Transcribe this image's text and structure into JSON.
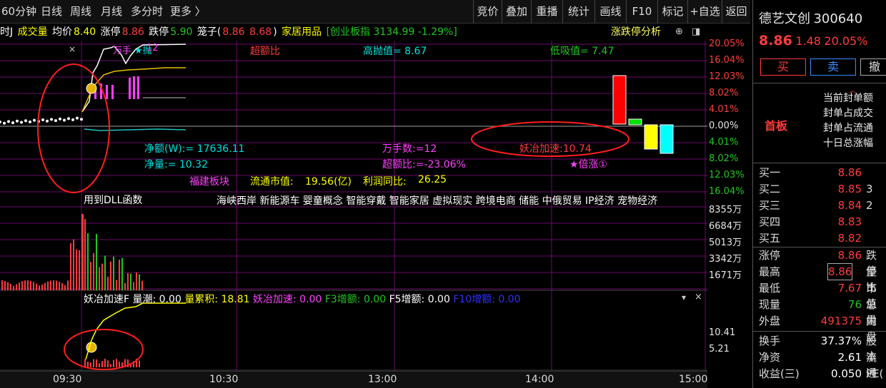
{
  "toolbar": {
    "periods": [
      "60分钟",
      "日线",
      "周线",
      "月线",
      "多分时",
      "更多 〉"
    ],
    "buttons": [
      "竞价",
      "叠加",
      "重播",
      "统计",
      "画线",
      "F10",
      "标记",
      "+自选",
      "返回"
    ]
  },
  "info": {
    "mode": "时J",
    "vol_label": "成交量",
    "avg_label": "均价",
    "avg": "8.40",
    "zt_label": "涨停",
    "zt": "8.86",
    "dt_label": "跌停",
    "dt": "5.90",
    "cage": "笼子(",
    "cage_lo": "8.86",
    "cage_hi": "8.68",
    ")": ")",
    "industry": "家居用品",
    "index": "[创业板指 3134.99 -1.29%]",
    "analysis": "涨跌停分析"
  },
  "chart": {
    "labels": {
      "wanshou": "万手",
      "paofu": "★抛",
      "num12": "12",
      "chaoe": "超额比",
      "gaopao": "高抛值= 8.67",
      "dixi": "低吸值= 7.47",
      "jinge": "净额(W):= 17636.11",
      "wanshoushu": "万手数:=12",
      "yaoye": "妖冶加速:10.74",
      "jingliang": "净量:= 10.32",
      "chaoebi": "超额比:=-23.06%",
      "beizhang": "★倍涨①",
      "region": "福建板块",
      "float": "流通市值:",
      "float_v": "19.56(亿)",
      "profit": "利润同比:",
      "profit_v": "26.25",
      "dll": "用到DLL函数",
      "concepts": "海峡西岸 新能源车 婴童概念 智能穿戴 智能家居 虚拟现实 跨境电商 储能 中俄贸易 IP经济 宠物经济"
    },
    "pct_axis": [
      {
        "t": "20.05%",
        "c": "#ff3c3c"
      },
      {
        "t": "16.04%",
        "c": "#ff3c3c"
      },
      {
        "t": "12.03%",
        "c": "#ff3c3c"
      },
      {
        "t": "8.02%",
        "c": "#ff3c3c"
      },
      {
        "t": "4.01%",
        "c": "#ff3c3c"
      },
      {
        "t": "0.00%",
        "c": "#e6e6e6"
      },
      {
        "t": "4.01%",
        "c": "#1ec81e"
      },
      {
        "t": "8.02%",
        "c": "#1ec81e"
      },
      {
        "t": "12.03%",
        "c": "#1ec81e"
      },
      {
        "t": "16.04%",
        "c": "#1ec81e"
      }
    ],
    "vol_axis": [
      "8355万",
      "6684万",
      "5013万",
      "3342万",
      "1671万"
    ],
    "ind_axis": [
      "10.41",
      "5.21"
    ],
    "ind_bar": {
      "name": "妖冶加速F",
      "vol": "量潮: 0.00",
      "cum": "量累积: 18.81",
      "acc": "妖冶加速: 0.00",
      "f3": "F3增额: 0.00",
      "f5": "F5增额: 0.00",
      "f10": "F10增额: 0.00"
    },
    "times": [
      "09:30",
      "10:30",
      "13:00",
      "14:00",
      "15:00"
    ],
    "close_x": "×"
  },
  "side": {
    "name": "德艺文创",
    "code": "300640",
    "price": "8.86",
    "change": "1.48",
    "pct": "20.05%",
    "buy": "买",
    "sell": "卖",
    "more": "撤",
    "board": "首板",
    "seal": [
      "当前封单额",
      "封单占成交",
      "封单占流通",
      "十日总涨幅"
    ],
    "bids": [
      {
        "l": "买一",
        "p": "8.86",
        "v": ""
      },
      {
        "l": "买二",
        "p": "8.85",
        "v": "3"
      },
      {
        "l": "买三",
        "p": "8.84",
        "v": "2"
      },
      {
        "l": "买四",
        "p": "8.83",
        "v": ""
      },
      {
        "l": "买五",
        "p": "8.82",
        "v": ""
      }
    ],
    "stats": [
      {
        "l": "涨停",
        "v": "8.86",
        "r": "跌停"
      },
      {
        "l": "最高",
        "v": "8.86",
        "r": "量比"
      },
      {
        "l": "最低",
        "v": "7.67",
        "r": "市值"
      },
      {
        "l": "现量",
        "v": "76",
        "r": "总量"
      },
      {
        "l": "外盘",
        "v": "491375",
        "r": "内盘"
      }
    ],
    "stats2": [
      {
        "l": "换手",
        "v": "37.37%",
        "r": "股本"
      },
      {
        "l": "净资",
        "v": "2.61",
        "r": "流通"
      },
      {
        "l": "收益(三)",
        "v": "0.050",
        "r": "PE("
      }
    ]
  }
}
